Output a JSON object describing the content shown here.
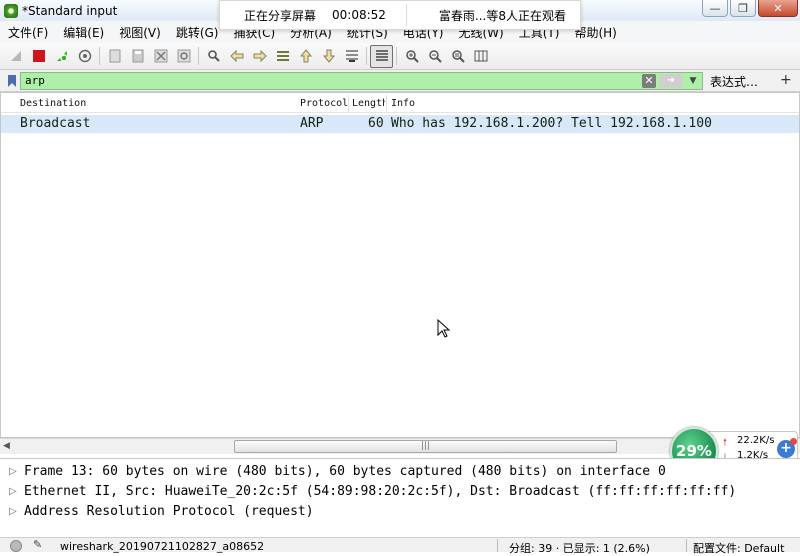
{
  "window": {
    "title": "*Standard input"
  },
  "share_bar": {
    "status": "正在分享屏幕",
    "timer": "00:08:52",
    "viewers": "富春雨...等8人正在观看"
  },
  "menu": [
    "文件(F)",
    "编辑(E)",
    "视图(V)",
    "跳转(G)",
    "捕获(C)",
    "分析(A)",
    "统计(S)",
    "电话(Y)",
    "无线(W)",
    "工具(T)",
    "帮助(H)"
  ],
  "toolbar": {
    "icons": [
      "shark-fin-icon",
      "stop-icon",
      "restart-icon",
      "options-icon",
      "open-icon",
      "save-icon",
      "close-file-icon",
      "reload-icon",
      "find-icon",
      "back-icon",
      "forward-icon",
      "goto-icon",
      "first-icon",
      "last-icon",
      "autoscroll-icon",
      "colorize-icon",
      "zoom-in-icon",
      "zoom-out-icon",
      "zoom-reset-icon",
      "resize-columns-icon"
    ]
  },
  "filter": {
    "value": "arp",
    "expressions_label": "表达式…",
    "add_label": "+"
  },
  "packet_list": {
    "columns": [
      "Destination",
      "Protocol",
      "Length",
      "Info"
    ],
    "rows": [
      {
        "destination": "Broadcast",
        "protocol": "ARP",
        "length": "60",
        "info": "Who has 192.168.1.200? Tell 192.168.1.100"
      }
    ]
  },
  "details": [
    "Frame 13: 60 bytes on wire (480 bits), 60 bytes captured (480 bits) on interface 0",
    "Ethernet II, Src: HuaweiTe_20:2c:5f (54:89:98:20:2c:5f), Dst: Broadcast (ff:ff:ff:ff:ff:ff)",
    "Address Resolution Protocol (request)"
  ],
  "net_widget": {
    "percent": "29%",
    "up": "22.2K/s",
    "down": "1.2K/s",
    "boost": "+"
  },
  "status": {
    "file": "wireshark_20190721102827_a08652",
    "packets": "分组: 39 · 已显示: 1 (2.6%)",
    "profile": "配置文件: Default"
  }
}
